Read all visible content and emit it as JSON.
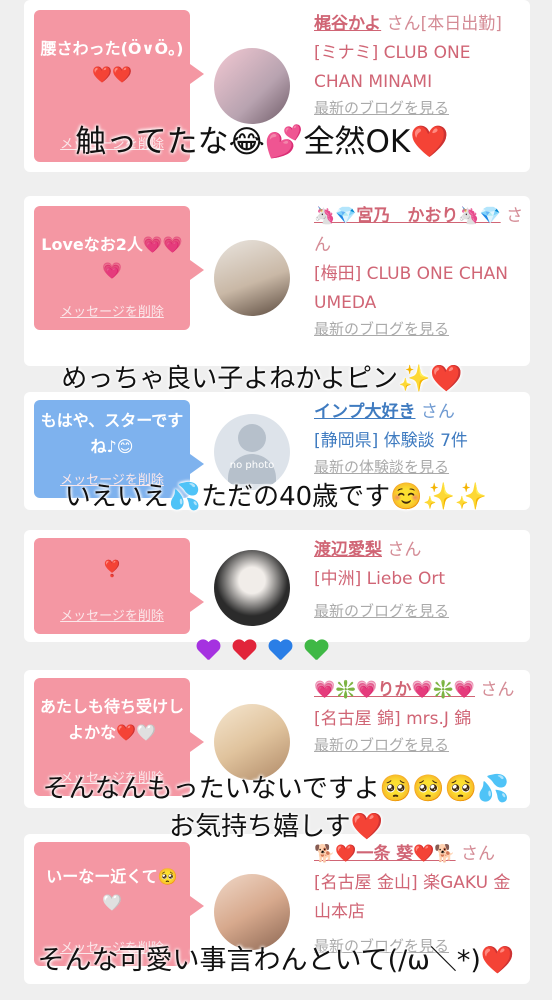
{
  "cards": [
    {
      "message": "腰さわった(Ö∨Ö。)❤️❤️",
      "delete_label": "メッセージを削除",
      "name": "梶谷かよ",
      "honorific": "さん",
      "status": "[本日出勤]",
      "shop": "[ミナミ] CLUB ONE CHAN MINAMI",
      "blog": "最新のブログを見る",
      "bubble_color": "pink"
    },
    {
      "message": "Loveなお2人💗💗💗",
      "delete_label": "メッセージを削除",
      "name": "🦄💎宮乃　かおり🦄💎",
      "honorific": "さん",
      "shop": "[梅田] CLUB ONE CHAN UMEDA",
      "blog": "最新のブログを見る",
      "bubble_color": "pink"
    },
    {
      "message": "もはや、スターですね♪😊",
      "delete_label": "メッセージを削除",
      "name": "インプ大好き",
      "honorific": "さん",
      "shop": "[静岡県] 体験談 7件",
      "blog": "最新の体験談を見る",
      "avatar_text": "no photo",
      "bubble_color": "blue"
    },
    {
      "message": "❣️",
      "delete_label": "メッセージを削除",
      "name": "渡辺愛梨",
      "honorific": "さん",
      "shop": "[中洲] Liebe Ort",
      "blog": "最新のブログを見る",
      "bubble_color": "pink"
    },
    {
      "message": "あたしも待ち受けしよかな❤️🤍",
      "delete_label": "メッセージを削除",
      "name": "💗❇️💗りか💗❇️💗",
      "honorific": "さん",
      "shop": "[名古屋 錦] mrs.J 錦",
      "blog": "最新のブログを見る",
      "bubble_color": "pink"
    },
    {
      "message": "いーなー近くて🥺🤍",
      "delete_label": "メッセージを削除",
      "name": "🐕❤️一条 葵❤️🐕",
      "honorific": "さん",
      "shop": "[名古屋 金山] 楽GAKU 金山本店",
      "blog": "最新のブログを見る",
      "bubble_color": "pink"
    }
  ],
  "overlays": [
    "触ってたな😂💕全然OK❤️",
    "めっちゃ良い子よねかよピン✨❤️",
    "いえいえ💦ただの40歳です☺️✨✨",
    "そんなんもったいないですよ🥺🥺🥺💦",
    "お気持ち嬉しす❤️",
    "そんな可愛い事言わんといて(/ω＼*)❤️"
  ],
  "hearts": [
    "#a532e0",
    "#e1243a",
    "#2a7ee6",
    "#3fb845"
  ]
}
